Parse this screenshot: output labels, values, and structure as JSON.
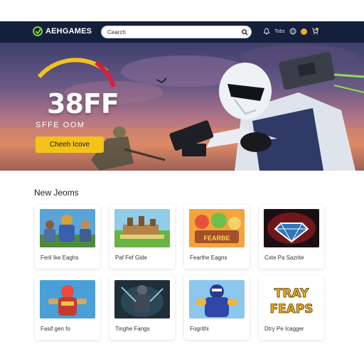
{
  "header": {
    "brand": "AEHGAMES",
    "search": {
      "value": "Cearch",
      "placeholder": "Search"
    },
    "nav_text": "Tobs"
  },
  "hero": {
    "headline": "38FF",
    "subtitle": "SFFE OOM",
    "cta_label": "Cheeh Icove"
  },
  "section": {
    "title": "New Jeoms"
  },
  "games": [
    {
      "title": "Feril Ike Eaghs"
    },
    {
      "title": "Paf Fef Gide"
    },
    {
      "title": "Fearthe Eagns"
    },
    {
      "title": "Cxte Pa Sazrite"
    },
    {
      "title": "Fasif gen fo"
    },
    {
      "title": "Tinghe Fangs"
    },
    {
      "title": "Fogrithi"
    },
    {
      "title": "Dtry Pe Icagger"
    }
  ],
  "thumb_text": {
    "game3_banner": "FEARBE",
    "game8_line1": "TRAY",
    "game8_line2": "FEAPS"
  },
  "icons": [
    "logo-icon",
    "search-icon",
    "bell-icon",
    "globe-icon",
    "coin-icon",
    "cart-icon"
  ],
  "colors": {
    "navbar": "#131f3b",
    "cta": "#f3c21b",
    "gauge_yellow": "#f3c21b",
    "gauge_red": "#d61f3a"
  }
}
